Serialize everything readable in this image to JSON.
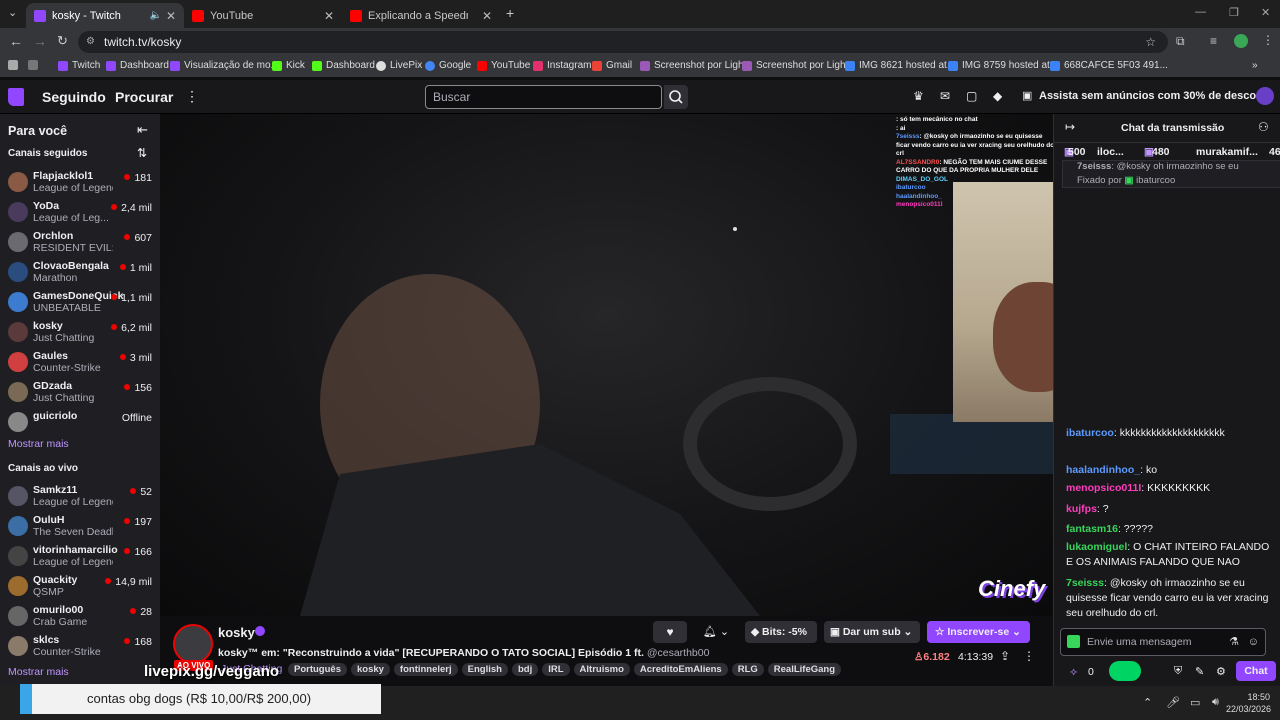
{
  "browser": {
    "tabs": [
      {
        "title": "kosky - Twitch"
      },
      {
        "title": "YouTube"
      },
      {
        "title": "Explicando a Speedrun de"
      }
    ],
    "url": "twitch.tv/kosky",
    "bookmarks": [
      "Twitch",
      "Dashboard",
      "Visualização de mo...",
      "Kick",
      "Dashboard",
      "LivePix",
      "Google",
      "YouTube",
      "Instagram",
      "Gmail",
      "Screenshot por Ligh...",
      "Screenshot por Ligh...",
      "IMG 8621 hosted at...",
      "IMG 8759 hosted at...",
      "668CAFCE 5F03 491..."
    ]
  },
  "topnav": {
    "following": "Seguindo",
    "browse": "Procurar",
    "search_placeholder": "Buscar",
    "promo": "Assista sem anúncios com 30% de desconto"
  },
  "sidebar": {
    "for_you": "Para você",
    "followed_title": "Canais seguidos",
    "followed": [
      {
        "name": "Flapjacklol1",
        "game": "League of Legends",
        "viewers": "181"
      },
      {
        "name": "YoDa",
        "game": "League of Leg...",
        "viewers": "2,4 mil"
      },
      {
        "name": "Orchlon",
        "game": "RESIDENT EVIL: r...",
        "viewers": "607"
      },
      {
        "name": "ClovaoBengala",
        "game": "Marathon",
        "viewers": "1 mil"
      },
      {
        "name": "GamesDoneQuick",
        "game": "UNBEATABLE",
        "viewers": "1,1 mil"
      },
      {
        "name": "kosky",
        "game": "Just Chatting",
        "viewers": "6,2 mil"
      },
      {
        "name": "Gaules",
        "game": "Counter-Strike",
        "viewers": "3 mil"
      },
      {
        "name": "GDzada",
        "game": "Just Chatting",
        "viewers": "156"
      },
      {
        "name": "guicriolo",
        "game": "",
        "viewers": "Offline"
      }
    ],
    "show_more": "Mostrar mais",
    "live_title": "Canais ao vivo",
    "live": [
      {
        "name": "Samkz11",
        "game": "League of Legends",
        "viewers": "52"
      },
      {
        "name": "OuluH",
        "game": "The Seven Deadl...",
        "viewers": "197"
      },
      {
        "name": "vitorinhamarcilio",
        "game": "League of Legends",
        "viewers": "166"
      },
      {
        "name": "Quackity",
        "game": "QSMP",
        "viewers": "14,9 mil"
      },
      {
        "name": "omurilo00",
        "game": "Crab Game",
        "viewers": "28"
      },
      {
        "name": "sklcs",
        "game": "Counter-Strike",
        "viewers": "168"
      }
    ],
    "show_more2": "Mostrar mais"
  },
  "overlay_chat": [
    {
      "user": "",
      "text": ": só tem mecânico no chat"
    },
    {
      "user": "",
      "text": ": ai"
    },
    {
      "user": "7seisss",
      "text": ": @kosky oh irmaozinho se eu quisesse ficar vendo carro eu ia ver xracing seu orelhudo do crl"
    },
    {
      "user": "AL7SSANDR0",
      "text": ": NEGÃO TEM MAIS CIUME DESSE CARRO DO QUE DA PROPRIA MULHER DELE"
    },
    {
      "user": "DIMAS_DO_GOL",
      "text": ""
    },
    {
      "user": "ibaturcoo",
      "text": ""
    },
    {
      "user": "haalandinhoo_",
      "text": ""
    },
    {
      "user": "menopsico011I",
      "text": ""
    }
  ],
  "stream": {
    "channel": "kosky",
    "title": "kosky™ em: \"Reconstruindo a vida\" [RECUPERANDO O TATO SOCIAL] Episódio 1 ft.",
    "mention": "@cesarthb00",
    "live_badge": "AO VIVO",
    "category": "Just Chatting",
    "tags": [
      "Português",
      "kosky",
      "fontinnelerj",
      "English",
      "bdj",
      "IRL",
      "Altruismo",
      "AcreditoEmAliens",
      "RLG",
      "RealLifeGang"
    ],
    "bits_label": "Bits: -5%",
    "sub_label": "Dar um sub",
    "subscribe_label": "Inscrever-se",
    "viewers": "6.182",
    "uptime": "4:13:39",
    "watermark": "Cinefy",
    "livepix": "livepix.gg/veggano"
  },
  "chat": {
    "title": "Chat da transmissão",
    "leaderboard": [
      {
        "name": "",
        "value": "500"
      },
      {
        "name": "iloc...",
        "value": ""
      },
      {
        "name": "",
        "value": "480"
      },
      {
        "name": "murakamif...",
        "value": ""
      },
      {
        "name": "",
        "value": "46"
      }
    ],
    "pinned_prefix": "Fixado por",
    "pinned_user": "ibaturcoo",
    "pinned_preview_user": "7seisss",
    "pinned_preview_text": "@kosky oh irmaozinho se eu",
    "messages": [
      {
        "user": "ibaturcoo",
        "color": "#5b9bff",
        "text": "kkkkkkkkkkkkkkkkkkkk"
      },
      {
        "user": "haalandinhoo_",
        "color": "#5b9bff",
        "text": "ko"
      },
      {
        "user": "menopsico011I",
        "color": "#ff3cbe",
        "text": "KKKKKKKKK"
      },
      {
        "user": "kujfps",
        "color": "#ff3cbe",
        "text": "?"
      },
      {
        "user": "fantasm16",
        "color": "#37d65a",
        "text": "?????"
      },
      {
        "user": "lukaomiguel",
        "color": "#37d65a",
        "text": "O CHAT INTEIRO FALANDO E OS ANIMAIS FALANDO QUE NAO"
      },
      {
        "user": "7seisss",
        "color": "#37d65a",
        "text": "@kosky oh irmaozinho se eu quisesse ficar vendo carro eu ia ver xracing seu orelhudo do crl."
      }
    ],
    "input_placeholder": "Envie uma mensagem",
    "points": "0",
    "send_label": "Chat"
  },
  "donation": "contas obg dogs (R$ 10,00/R$ 200,00)",
  "taskbar": {
    "time": "18:50",
    "date": "22/03/2026"
  },
  "colors": {
    "twitch_purple": "#9147ff",
    "live_red": "#eb0400",
    "bg": "#0e0e10"
  }
}
